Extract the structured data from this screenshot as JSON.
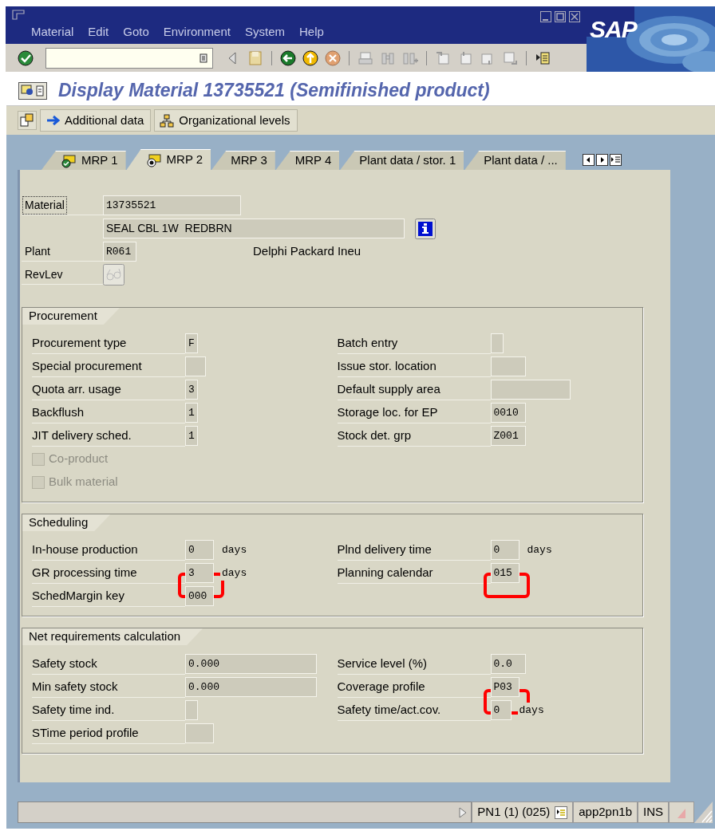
{
  "window": {
    "menu": [
      "Material",
      "Edit",
      "Goto",
      "Environment",
      "System",
      "Help"
    ],
    "logo": "SAP"
  },
  "title": "Display Material 13735521 (Semifinished product)",
  "app_toolbar": {
    "buttons": [
      {
        "label": "Additional data",
        "kind": "arrow"
      },
      {
        "label": "Organizational levels",
        "kind": "hierarchy"
      }
    ]
  },
  "tabs": [
    {
      "label": "MRP 1",
      "kind": "done",
      "selected": false
    },
    {
      "label": "MRP 2",
      "kind": "current",
      "selected": true
    },
    {
      "label": "MRP 3",
      "kind": "plain",
      "selected": false
    },
    {
      "label": "MRP 4",
      "kind": "plain",
      "selected": false
    },
    {
      "label": "Plant data / stor. 1",
      "kind": "plain",
      "selected": false
    },
    {
      "label": "Plant data / ...",
      "kind": "plain",
      "selected": false
    }
  ],
  "header": {
    "material_label": "Material",
    "material": "13735521",
    "description": "SEAL CBL 1W  REDBRN",
    "plant_label": "Plant",
    "plant": "R061",
    "plant_name": "Delphi Packard Ineu",
    "revlev_label": "RevLev"
  },
  "sections": [
    {
      "title": "Procurement",
      "left": [
        {
          "kind": "field",
          "label": "Procurement type",
          "value": "F"
        },
        {
          "kind": "field",
          "label": "Special procurement"
        },
        {
          "kind": "field",
          "label": "Quota arr. usage",
          "value": "3"
        },
        {
          "kind": "field",
          "label": "Backflush",
          "value": "1"
        },
        {
          "kind": "field",
          "label": "JIT delivery sched.",
          "value": "1"
        },
        {
          "kind": "checkbox",
          "label": "Co-product",
          "checked": false,
          "disabled": true
        },
        {
          "kind": "checkbox",
          "label": "Bulk material",
          "checked": false,
          "disabled": true
        }
      ],
      "right": [
        {
          "kind": "field",
          "label": "Batch entry"
        },
        {
          "kind": "field",
          "label": "Issue stor. location"
        },
        {
          "kind": "field",
          "label": "Default supply area"
        },
        {
          "kind": "field",
          "label": "Storage loc. for EP",
          "value": "0010"
        },
        {
          "kind": "field",
          "label": "Stock det. grp",
          "value": "Z001"
        }
      ]
    },
    {
      "title": "Scheduling",
      "left": [
        {
          "kind": "field",
          "label": "In-house production",
          "value": "0",
          "unit": "days"
        },
        {
          "kind": "field",
          "label": "GR processing time",
          "value": "3",
          "unit": "days",
          "highlighted": true
        },
        {
          "kind": "field",
          "label": "SchedMargin key",
          "value": "000"
        }
      ],
      "right": [
        {
          "kind": "field",
          "label": "Plnd delivery time",
          "value": "0",
          "unit": "days"
        },
        {
          "kind": "field",
          "label": "Planning calendar",
          "value": "015",
          "highlighted": true
        }
      ]
    },
    {
      "title": "Net requirements calculation",
      "left": [
        {
          "kind": "field",
          "label": "Safety stock",
          "value": "0.000"
        },
        {
          "kind": "field",
          "label": "Min safety stock",
          "value": "0.000"
        },
        {
          "kind": "field",
          "label": "Safety time ind."
        },
        {
          "kind": "field",
          "label": "STime period profile"
        }
      ],
      "right": [
        {
          "kind": "field",
          "label": "Service level (%)",
          "value": "0.0"
        },
        {
          "kind": "field",
          "label": "Coverage profile",
          "value": "P03"
        },
        {
          "kind": "field",
          "label": "Safety time/act.cov.",
          "value": "0",
          "unit": "days",
          "highlighted": true
        }
      ]
    }
  ],
  "status_bar": {
    "session": "PN1 (1) (025)",
    "server": "app2pn1b",
    "mode": "INS"
  }
}
